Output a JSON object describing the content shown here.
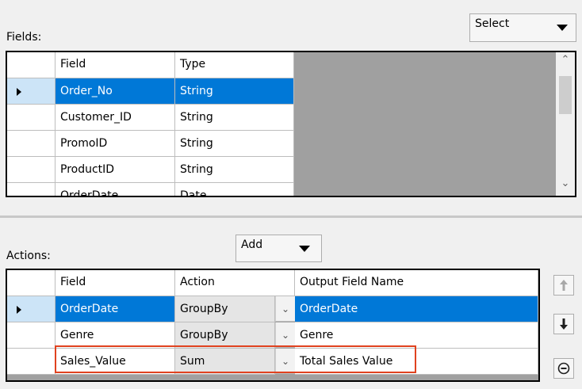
{
  "select_dropdown": {
    "label": "Select"
  },
  "fields": {
    "label": "Fields:",
    "columns": [
      "Field",
      "Type"
    ],
    "rows": [
      {
        "field": "Order_No",
        "type": "String"
      },
      {
        "field": "Customer_ID",
        "type": "String"
      },
      {
        "field": "PromoID",
        "type": "String"
      },
      {
        "field": "ProductID",
        "type": "String"
      },
      {
        "field": "OrderDate",
        "type": "Date"
      }
    ]
  },
  "add_dropdown": {
    "label": "Add"
  },
  "actions": {
    "label": "Actions:",
    "columns": [
      "Field",
      "Action",
      "Output Field Name"
    ],
    "rows": [
      {
        "field": "OrderDate",
        "action": "GroupBy",
        "output": "OrderDate"
      },
      {
        "field": "Genre",
        "action": "GroupBy",
        "output": "Genre"
      },
      {
        "field": "Sales_Value",
        "action": "Sum",
        "output": "Total Sales Value"
      }
    ]
  },
  "icons": {
    "move_up": "arrow-up-icon",
    "move_down": "arrow-down-icon",
    "remove": "minus-circle-icon"
  },
  "colors": {
    "selection": "#0078d7",
    "highlight": "#e0421f"
  }
}
